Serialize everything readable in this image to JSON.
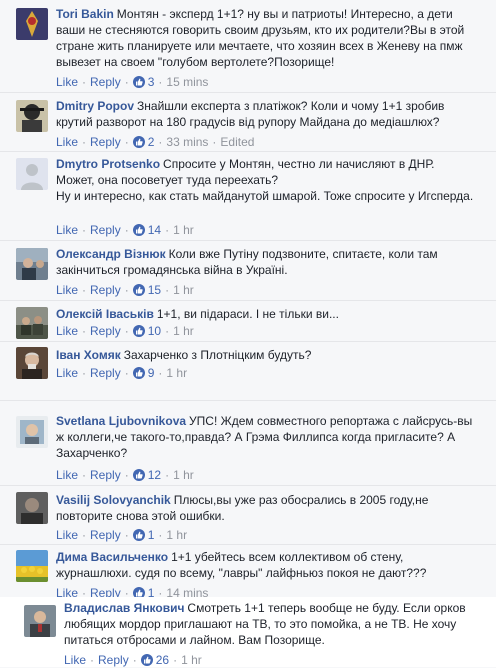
{
  "colors": {
    "link": "#365899",
    "action": "#4267b2",
    "meta": "#90949c",
    "background": "#f6f7f9"
  },
  "labels": {
    "like": "Like",
    "reply": "Reply",
    "dot": "·"
  },
  "comments": [
    {
      "author": "Tori Bakin",
      "text": "Монтян - эксперд 1+1? ну вы и патриоты! Интересно, а дети ваши не стесняются говорить своим друзьям, кто их родители?Вы в этой стране жить планируете или мечтаете, что хозяин всех в Женеву на пмж вывезет на своем \"голубом вертолете?Позорище!",
      "likes": "3",
      "time": "15 mins",
      "edited": ""
    },
    {
      "author": "Dmitry Popov",
      "text": "Знайшли експерта з платіжок? Коли и чому 1+1 зробив крутий разворот на 180 градусів від рупору Майдана до медіашлюх?",
      "likes": "2",
      "time": "33 mins",
      "edited": "Edited"
    },
    {
      "author": "Dmytro Protsenko",
      "text": "Спросите у Монтян, честно ли начисляют в ДНР. Может, она посоветует туда переехать?\nНу и интересно, как стать майданутой шмарой. Тоже спросите у Игсперда.",
      "likes": "14",
      "time": "1 hr",
      "edited": ""
    },
    {
      "author": "Олександр Візнюк",
      "text": "Коли вже Путіну подзвоните, спитаєте, коли там закінчиться громадянська війна в Україні.",
      "likes": "15",
      "time": "1 hr",
      "edited": ""
    },
    {
      "author": "Олексій Іваськів",
      "text": "1+1, ви підараси. І не тільки ви...",
      "likes": "10",
      "time": "1 hr",
      "edited": ""
    },
    {
      "author": "Іван Хомяк",
      "text": "Захарченко з Плотніцким будуть?",
      "likes": "9",
      "time": "1 hr",
      "edited": ""
    },
    {
      "author": "Svetlana Ljubovnikova",
      "text": "УПС! Ждем совместного репортажа с лайсрусь-вы ж коллеги,че такого-то,правда? А Грэма Филлипса когда пригласите? А Захарченко?",
      "likes": "12",
      "time": "1 hr",
      "edited": ""
    },
    {
      "author": "Vasilij Solovyanchik",
      "text": "Плюсы,вы уже раз обосрались в 2005 году,не повторите снова этой ошибки.",
      "likes": "1",
      "time": "1 hr",
      "edited": ""
    },
    {
      "author": "Дима Васильченко",
      "text": "1+1 убейтесь всем коллективом об стену, журнашлюхи. судя по всему, \"лавры\" лайфньюз покоя не дают???",
      "likes": "1",
      "time": "14 mins",
      "edited": ""
    },
    {
      "author": "Владислав Янкович",
      "text": "Смотреть 1+1 теперь вообще не буду. Если орков любящих мордор приглашают на ТВ, то это помойка, а не ТВ. Не хочу питаться отбросами и лайном. Вам Позорище.",
      "likes": "26",
      "time": "1 hr",
      "edited": ""
    }
  ]
}
